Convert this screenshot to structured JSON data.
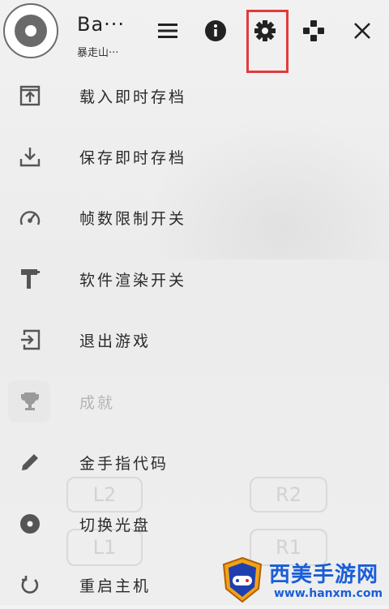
{
  "header": {
    "title": "Ba···",
    "subtitle": "暴走山···",
    "icons": [
      "disc-icon",
      "menu-icon",
      "info-icon",
      "gear-icon",
      "gamepad-icon",
      "close-icon"
    ]
  },
  "menu": {
    "items": [
      {
        "label": "载入即时存档",
        "icon": "load-state-icon",
        "enabled": true
      },
      {
        "label": "保存即时存档",
        "icon": "save-state-icon",
        "enabled": true
      },
      {
        "label": "帧数限制开关",
        "icon": "speedometer-icon",
        "enabled": true
      },
      {
        "label": "软件渲染开关",
        "icon": "paint-roller-icon",
        "enabled": true
      },
      {
        "label": "退出游戏",
        "icon": "exit-icon",
        "enabled": true
      },
      {
        "label": "成就",
        "icon": "trophy-icon",
        "enabled": false
      },
      {
        "label": "金手指代码",
        "icon": "pencil-icon",
        "enabled": true
      },
      {
        "label": "切换光盘",
        "icon": "disc-small-icon",
        "enabled": true
      },
      {
        "label": "重启主机",
        "icon": "restart-icon",
        "enabled": true
      }
    ]
  },
  "background": {
    "buttons": [
      "L2",
      "R2",
      "L1",
      "R1"
    ]
  },
  "watermark": {
    "text": "西美手游网",
    "url": "www.hanxm.com"
  },
  "colors": {
    "highlight": "#e23b3b",
    "icon": "#555555",
    "watermark": "#1a5ed8"
  }
}
